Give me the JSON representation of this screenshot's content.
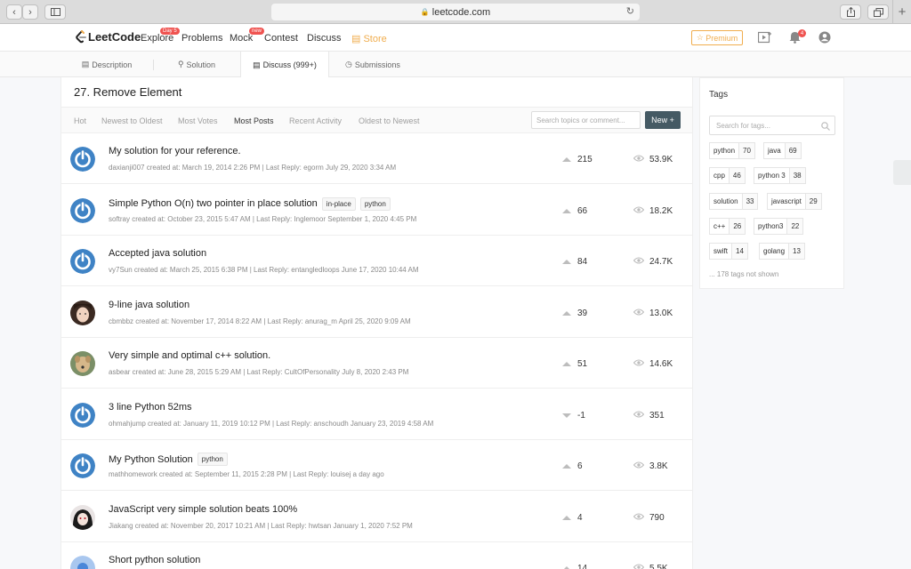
{
  "browser": {
    "url": "leetcode.com"
  },
  "nav": {
    "logo": "LeetCode",
    "items": [
      {
        "label": "Explore",
        "badge": "Day 5"
      },
      {
        "label": "Problems"
      },
      {
        "label": "Mock",
        "badge": "new"
      },
      {
        "label": "Contest"
      },
      {
        "label": "Discuss"
      },
      {
        "label": "Store"
      }
    ],
    "premium": "Premium",
    "notifications": "4"
  },
  "tabs": [
    {
      "label": "Description"
    },
    {
      "label": "Solution"
    },
    {
      "label": "Discuss (999+)",
      "active": true
    },
    {
      "label": "Submissions"
    }
  ],
  "problem_title": "27. Remove Element",
  "sort_options": [
    "Hot",
    "Newest to Oldest",
    "Most Votes",
    "Most Posts",
    "Recent Activity",
    "Oldest to Newest"
  ],
  "sort_active": "Most Posts",
  "search_placeholder": "Search topics or comment...",
  "new_button": "New",
  "posts": [
    {
      "title": "My solution for your reference.",
      "tags": [],
      "meta": "daxianji007 created at: March 19, 2014 2:26 PM | Last Reply: egorm July 29, 2020 3:34 AM",
      "votes": "215",
      "vote_dir": "up",
      "views": "53.9K",
      "avatar": "default"
    },
    {
      "title": "Simple Python O(n) two pointer in place solution",
      "tags": [
        "in-place",
        "python"
      ],
      "meta": "softray created at: October 23, 2015 5:47 AM | Last Reply: Inglemoor September 1, 2020 4:45 PM",
      "votes": "66",
      "vote_dir": "up",
      "views": "18.2K",
      "avatar": "default"
    },
    {
      "title": "Accepted java solution",
      "tags": [],
      "meta": "vy7Sun created at: March 25, 2015 6:38 PM | Last Reply: entangledloops June 17, 2020 10:44 AM",
      "votes": "84",
      "vote_dir": "up",
      "views": "24.7K",
      "avatar": "default"
    },
    {
      "title": "9-line java solution",
      "tags": [],
      "meta": "cbmbbz created at: November 17, 2014 8:22 AM | Last Reply: anurag_m April 25, 2020 9:09 AM",
      "votes": "39",
      "vote_dir": "up",
      "views": "13.0K",
      "avatar": "photo-girl"
    },
    {
      "title": "Very simple and optimal c++ solution.",
      "tags": [],
      "meta": "asbear created at: June 28, 2015 5:29 AM | Last Reply: CultOfPersonality July 8, 2020 2:43 PM",
      "votes": "51",
      "vote_dir": "up",
      "views": "14.6K",
      "avatar": "photo-dog"
    },
    {
      "title": "3 line Python 52ms",
      "tags": [],
      "meta": "ohmahjump created at: January 11, 2019 10:12 PM | Last Reply: anschoudh January 23, 2019 4:58 AM",
      "votes": "-1",
      "vote_dir": "down",
      "views": "351",
      "avatar": "default"
    },
    {
      "title": "My Python Solution",
      "tags": [
        "python"
      ],
      "meta": "mathhomework created at: September 11, 2015 2:28 PM | Last Reply: louisej a day ago",
      "votes": "6",
      "vote_dir": "up",
      "views": "3.8K",
      "avatar": "default"
    },
    {
      "title": "JavaScript very simple solution beats 100%",
      "tags": [],
      "meta": "Jiakang created at: November 20, 2017 10:21 AM | Last Reply: hwtsan January 1, 2020 7:52 PM",
      "votes": "4",
      "vote_dir": "up",
      "views": "790",
      "avatar": "photo-anime"
    },
    {
      "title": "Short python solution",
      "tags": [],
      "meta": "",
      "votes": "14",
      "vote_dir": "up",
      "views": "5.5K",
      "avatar": "circle-blue"
    }
  ],
  "tags_panel": {
    "title": "Tags",
    "search_placeholder": "Search for tags...",
    "tags": [
      {
        "name": "python",
        "count": "70"
      },
      {
        "name": "java",
        "count": "69"
      },
      {
        "name": "cpp",
        "count": "46"
      },
      {
        "name": "python 3",
        "count": "38"
      },
      {
        "name": "solution",
        "count": "33"
      },
      {
        "name": "javascript",
        "count": "29"
      },
      {
        "name": "c++",
        "count": "26"
      },
      {
        "name": "python3",
        "count": "22"
      },
      {
        "name": "swift",
        "count": "14"
      },
      {
        "name": "golang",
        "count": "13"
      }
    ],
    "not_shown": "... 178 tags not shown"
  },
  "colors": {
    "accent": "#455a64",
    "brand_orange": "#f0ad4e",
    "badge_red": "#ef5350",
    "avatar_blue": "#3f83c5"
  }
}
